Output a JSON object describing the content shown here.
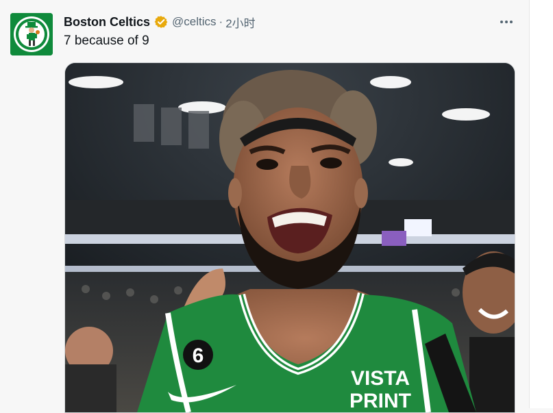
{
  "tweet": {
    "author_name": "Boston Celtics",
    "handle": "@celtics",
    "separator": "·",
    "time": "2小时",
    "text": "7 because of 9",
    "more_icon": "more-horizontal-icon",
    "verified_icon": "verified-badge-icon",
    "verified_color": "#e8a90c"
  },
  "colors": {
    "celtics_green": "#0f8a3b",
    "jersey_green": "#1f8a3e",
    "text_primary": "#0f1419",
    "text_secondary": "#536471"
  },
  "media": {
    "jersey_number": "6",
    "jersey_sponsor_line1": "VISTA",
    "jersey_sponsor_line2": "PRINT"
  }
}
